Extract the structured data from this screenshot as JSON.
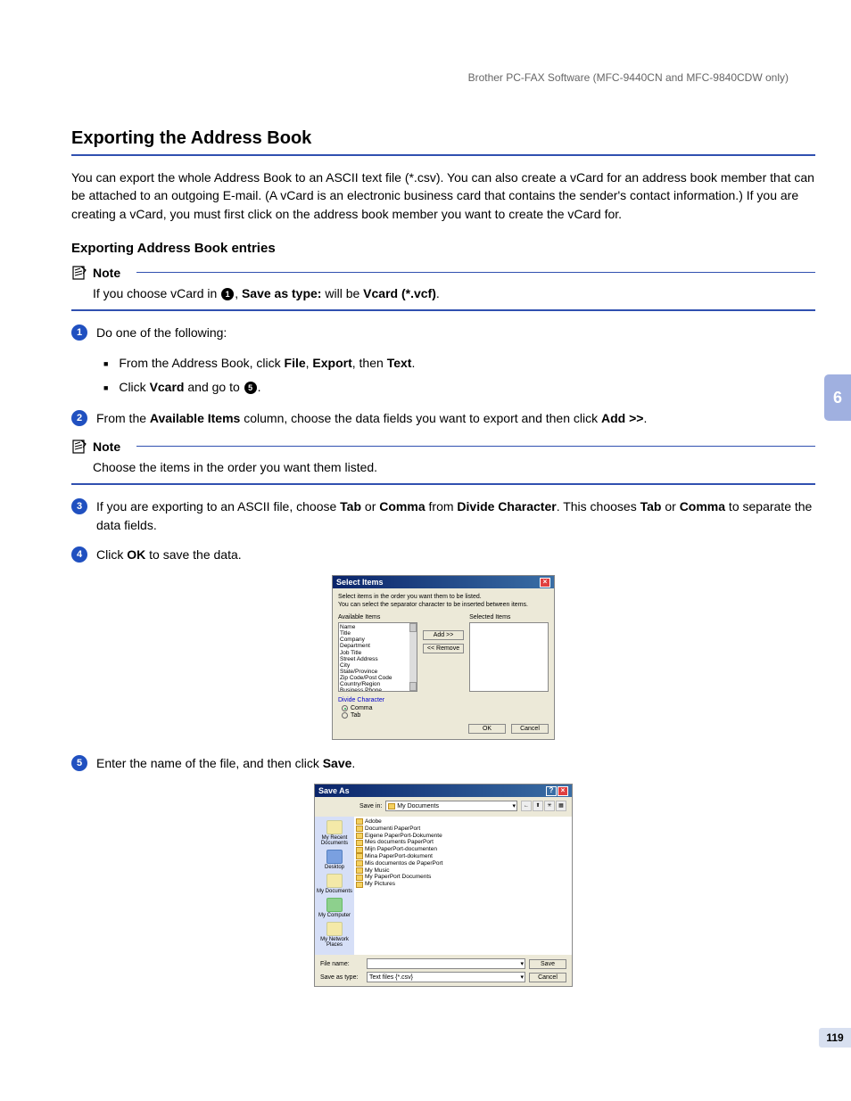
{
  "header": "Brother PC-FAX Software (MFC-9440CN and MFC-9840CDW only)",
  "chapter_tab": "6",
  "page_number": "119",
  "h1": "Exporting the Address Book",
  "intro": "You can export the whole Address Book to an ASCII text file (*.csv). You can also create a vCard for an address book member that can be attached to an outgoing E-mail. (A vCard is an electronic business card that contains the sender's contact information.) If you are creating a vCard, you must first click on the address book member you want to create the vCard for.",
  "h2": "Exporting Address Book entries",
  "note1": {
    "title": "Note",
    "body_pre": "If you choose vCard in ",
    "body_ref": "1",
    "body_mid": ", ",
    "body_bold1": "Save as type:",
    "body_mid2": " will be ",
    "body_bold2": "Vcard (*.vcf)",
    "body_post": "."
  },
  "step1": {
    "num": "1",
    "text": "Do one of the following:",
    "bullet1_pre": "From the Address Book, click ",
    "bullet1_b1": "File",
    "bullet1_c1": ", ",
    "bullet1_b2": "Export",
    "bullet1_c2": ", then ",
    "bullet1_b3": "Text",
    "bullet1_post": ".",
    "bullet2_pre": "Click ",
    "bullet2_b1": "Vcard",
    "bullet2_mid": " and go to ",
    "bullet2_ref": "5",
    "bullet2_post": "."
  },
  "step2": {
    "num": "2",
    "pre": "From the ",
    "b1": "Available Items",
    "mid": " column, choose the data fields you want to export and then click ",
    "b2": "Add >>",
    "post": "."
  },
  "note2": {
    "title": "Note",
    "body": "Choose the items in the order you want them listed."
  },
  "step3": {
    "num": "3",
    "pre": "If you are exporting to an ASCII file, choose ",
    "b1": "Tab",
    "mid1": " or ",
    "b2": "Comma",
    "mid2": " from ",
    "b3": "Divide Character",
    "mid3": ". This chooses ",
    "b4": "Tab",
    "mid4": " or ",
    "b5": "Comma",
    "post": " to separate the data fields."
  },
  "step4": {
    "num": "4",
    "pre": "Click ",
    "b1": "OK",
    "post": " to save the data."
  },
  "step5": {
    "num": "5",
    "pre": "Enter the name of the file, and then click ",
    "b1": "Save",
    "post": "."
  },
  "select_dialog": {
    "title": "Select Items",
    "line1": "Select items in the order you want them to be listed.",
    "line2": "You can select the separator character to be inserted between items.",
    "available_label": "Available Items",
    "selected_label": "Selected Items",
    "items": [
      "Name",
      "Title",
      "Company",
      "Department",
      "Job Title",
      "Street Address",
      "City",
      "State/Province",
      "Zip Code/Post Code",
      "Country/Region",
      "Business Phone"
    ],
    "add_btn": "Add >>",
    "remove_btn": "<< Remove",
    "divide_title": "Divide Character",
    "radio_comma": "Comma",
    "radio_tab": "Tab",
    "ok": "OK",
    "cancel": "Cancel"
  },
  "save_dialog": {
    "title": "Save As",
    "save_in_label": "Save in:",
    "save_in_value": "My Documents",
    "sidebar": [
      "My Recent Documents",
      "Desktop",
      "My Documents",
      "My Computer",
      "My Network Places"
    ],
    "folders": [
      "Adobe",
      "Documenti PaperPort",
      "Eigene PaperPort-Dokumente",
      "Mes documents PaperPort",
      "Mijn PaperPort-documenten",
      "Mina PaperPort-dokument",
      "Mis documentos de PaperPort",
      "My Music",
      "My PaperPort Documents",
      "My Pictures"
    ],
    "file_name_label": "File name:",
    "file_name_value": "",
    "save_type_label": "Save as type:",
    "save_type_value": "Text files {*.csv}",
    "save_btn": "Save",
    "cancel_btn": "Cancel"
  }
}
